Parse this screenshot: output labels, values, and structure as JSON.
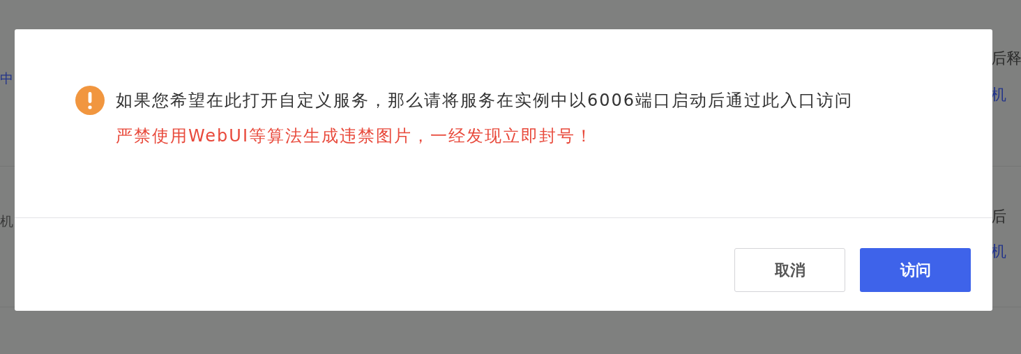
{
  "background": {
    "left": [
      {
        "text": "中",
        "kind": "link"
      },
      {
        "text": "机",
        "kind": "plain"
      }
    ],
    "right": [
      {
        "text": "后释",
        "kind": "plain"
      },
      {
        "text": "机",
        "kind": "link"
      },
      {
        "text": "后",
        "kind": "plain"
      },
      {
        "text": "机",
        "kind": "link"
      }
    ]
  },
  "dialog": {
    "message": "如果您希望在此打开自定义服务，那么请将服务在实例中以6006端口启动后通过此入口访问",
    "warning": "严禁使用WebUI等算法生成违禁图片，一经发现立即封号！",
    "buttons": [
      {
        "label": "取消",
        "kind": "secondary"
      },
      {
        "label": "访问",
        "kind": "primary"
      }
    ]
  }
}
